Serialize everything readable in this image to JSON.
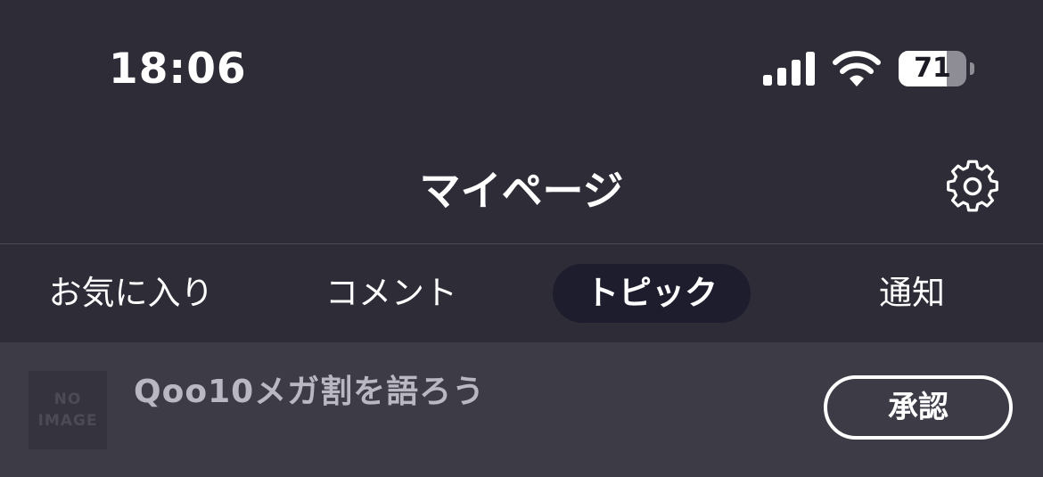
{
  "status_bar": {
    "time": "18:06",
    "battery_level": 71,
    "battery_text": "71",
    "icons": [
      "cellular-signal-icon",
      "wifi-icon",
      "battery-icon"
    ]
  },
  "header": {
    "title": "マイページ",
    "settings_icon": "gear-icon"
  },
  "tabs": [
    {
      "label": "お気に入り",
      "active": false
    },
    {
      "label": "コメント",
      "active": false
    },
    {
      "label": "トピック",
      "active": true
    },
    {
      "label": "通知",
      "active": false
    }
  ],
  "list": {
    "items": [
      {
        "thumbnail_text_line1": "NO",
        "thumbnail_text_line2": "IMAGE",
        "title": "Qoo10メガ割を語ろう",
        "action_label": "承認"
      }
    ]
  },
  "colors": {
    "background": "#2d2c37",
    "active_tab": "#1e1d2e",
    "list_row": "#3c3b46",
    "item_title": "#b9b8c2"
  }
}
